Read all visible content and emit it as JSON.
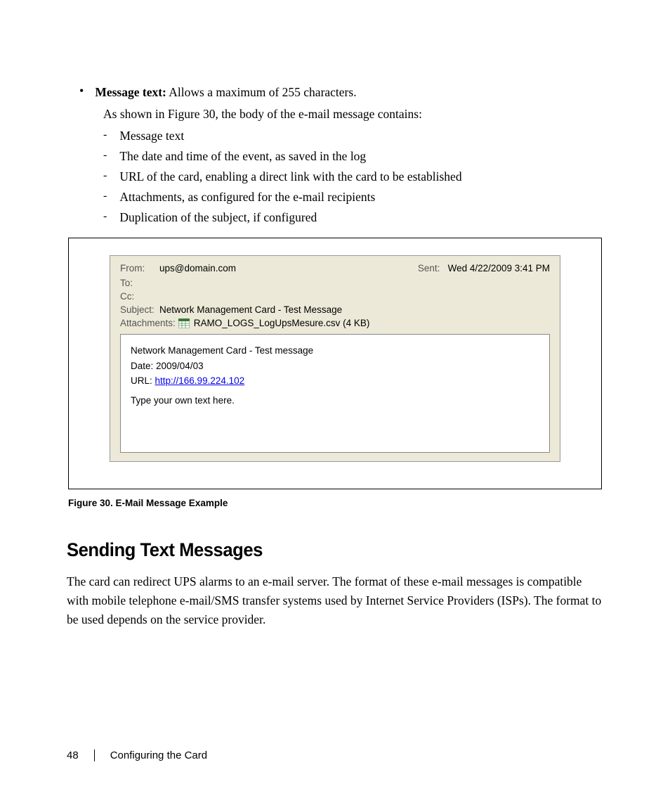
{
  "bullet": {
    "label": "Message text:",
    "desc": " Allows a maximum of 255 characters."
  },
  "intro": "As shown in Figure 30, the body of the e-mail message contains:",
  "dash_items": [
    "Message text",
    "The date and time of the event, as saved in the log",
    "URL of the card, enabling a direct link with the card to be established",
    "Attachments, as configured for the e-mail recipients",
    "Duplication of the subject, if configured"
  ],
  "email": {
    "from_label": "From:",
    "from_value": "ups@domain.com",
    "sent_label": "Sent:",
    "sent_value": "Wed 4/22/2009 3:41 PM",
    "to_label": "To:",
    "cc_label": "Cc:",
    "subject_label": "Subject:",
    "subject_value": "Network Management Card - Test Message",
    "attachments_label": "Attachments:",
    "attachments_value": "RAMO_LOGS_LogUpsMesure.csv (4 KB)",
    "body_line1": "Network Management Card - Test message",
    "body_line2": "Date: 2009/04/03",
    "body_url_label": "URL: ",
    "body_url": "http://166.99.224.102",
    "body_line4": "Type your own text here."
  },
  "figure_caption": "Figure 30. E-Mail Message Example",
  "heading": "Sending Text Messages",
  "paragraph": "The card can redirect UPS alarms to an e-mail server. The format of these e-mail messages is compatible with mobile telephone e-mail/SMS transfer systems used by Internet Service Providers (ISPs). The format to be used depends on the service provider.",
  "footer": {
    "page": "48",
    "text": "Configuring the Card"
  }
}
